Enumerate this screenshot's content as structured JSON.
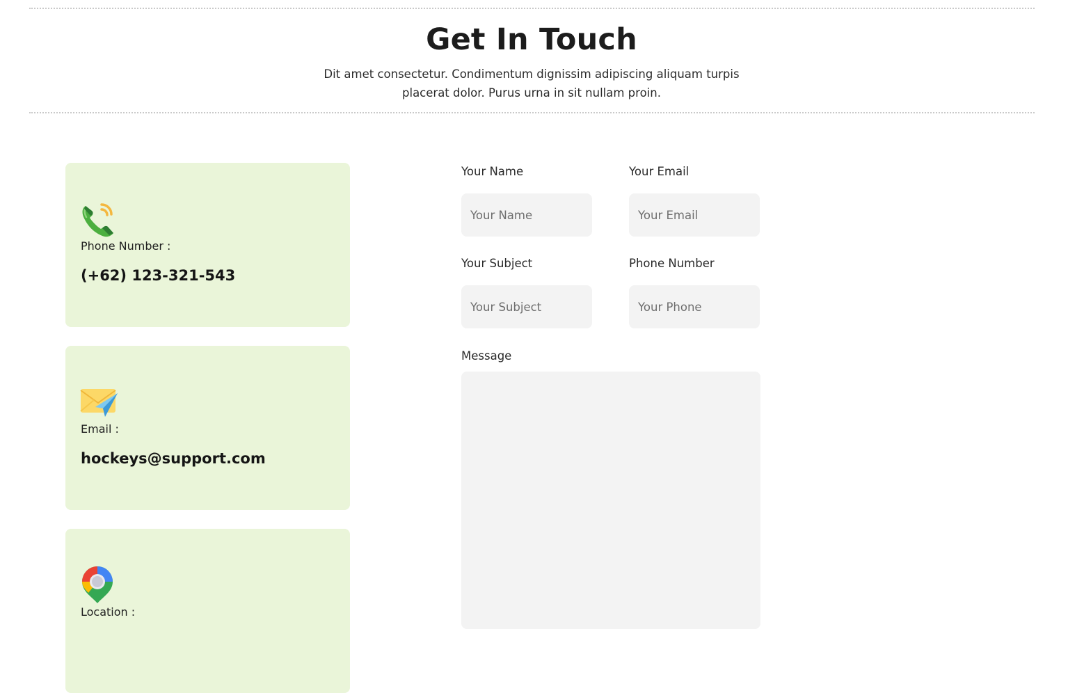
{
  "header": {
    "title": "Get In Touch",
    "subtitle": "Dit amet consectetur. Condimentum dignissim adipiscing aliquam turpis placerat dolor. Purus urna in sit nullam proin."
  },
  "contact_cards": {
    "phone": {
      "icon": "phone-icon",
      "label": "Phone Number :",
      "value": "(+62) 123-321-543"
    },
    "email": {
      "icon": "email-icon",
      "label": "Email :",
      "value": "hockeys@support.com"
    },
    "location": {
      "icon": "location-pin-icon",
      "label": "Location :"
    }
  },
  "form": {
    "name": {
      "label": "Your Name",
      "placeholder": "Your Name",
      "value": ""
    },
    "email": {
      "label": "Your Email",
      "placeholder": "Your Email",
      "value": ""
    },
    "subject": {
      "label": "Your Subject",
      "placeholder": "Your Subject",
      "value": ""
    },
    "phone": {
      "label": "Phone Number",
      "placeholder": "Your Phone",
      "value": ""
    },
    "message": {
      "label": "Message",
      "placeholder": "",
      "value": ""
    }
  },
  "colors": {
    "card_background": "#eaf5d9",
    "field_background": "#f3f3f3",
    "divider": "#c9c9c9"
  }
}
